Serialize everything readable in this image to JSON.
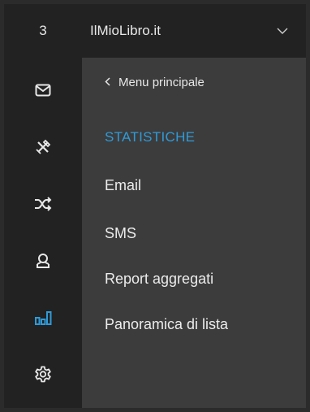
{
  "account": {
    "number": "3",
    "name": "IlMioLibro.it",
    "dropdown_icon": "chevron-down-icon"
  },
  "rail": {
    "items": [
      {
        "icon": "mail-icon",
        "active": false
      },
      {
        "icon": "tools-icon",
        "active": false
      },
      {
        "icon": "shuffle-icon",
        "active": false
      },
      {
        "icon": "user-icon",
        "active": false
      },
      {
        "icon": "bar-chart-icon",
        "active": true
      },
      {
        "icon": "gear-icon",
        "active": false
      }
    ]
  },
  "submenu": {
    "back_label": "Menu principale",
    "section_title": "STATISTICHE",
    "items": [
      {
        "label": "Email"
      },
      {
        "label": "SMS"
      },
      {
        "label": "Report aggregati"
      },
      {
        "label": "Panoramica di lista"
      }
    ]
  },
  "colors": {
    "accent": "#2f9bd8",
    "rail_bg": "#222222",
    "panel_bg": "#3c3c3c",
    "text": "#ececec"
  }
}
